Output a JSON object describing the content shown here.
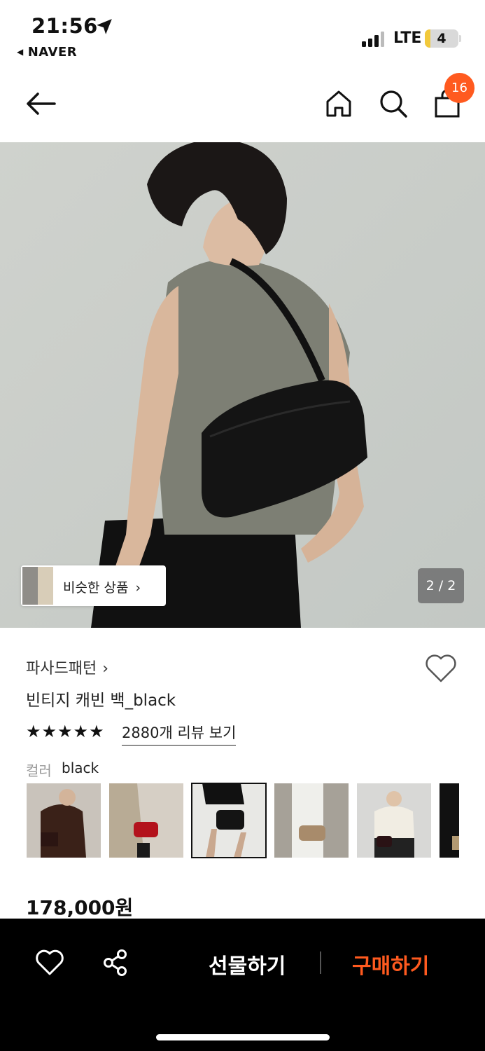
{
  "status_bar": {
    "time": "21:56",
    "back_app": "NAVER",
    "network": "LTE",
    "battery": "4",
    "battery_level": 0.16,
    "location_icon": "location-arrow-icon",
    "signal_icon": "signal-bars-icon"
  },
  "nav": {
    "back_icon": "arrow-left-icon",
    "home_icon": "home-icon",
    "search_icon": "search-icon",
    "bag_icon": "shopping-bag-icon",
    "cart_count": "16"
  },
  "gallery": {
    "similar_label": "비슷한 상품",
    "counter": "2 / 2"
  },
  "product": {
    "brand": "파사드패턴",
    "name": "빈티지 캐빈 백_black",
    "stars": "★★★★★",
    "rating_stars": 5,
    "reviews": "2880개 리뷰 보기",
    "color_label": "컬러",
    "color_value": "black",
    "price": "178,000원"
  },
  "swatches": [
    {
      "selected": false
    },
    {
      "selected": false
    },
    {
      "selected": true
    },
    {
      "selected": false
    },
    {
      "selected": false
    },
    {
      "selected": false
    }
  ],
  "bottom_bar": {
    "gift_label": "선물하기",
    "buy_label": "구매하기",
    "heart_icon": "heart-outline-icon",
    "share_icon": "share-icon"
  },
  "colors": {
    "accent": "#ff5a1f",
    "bottom_bar": "#000000"
  }
}
